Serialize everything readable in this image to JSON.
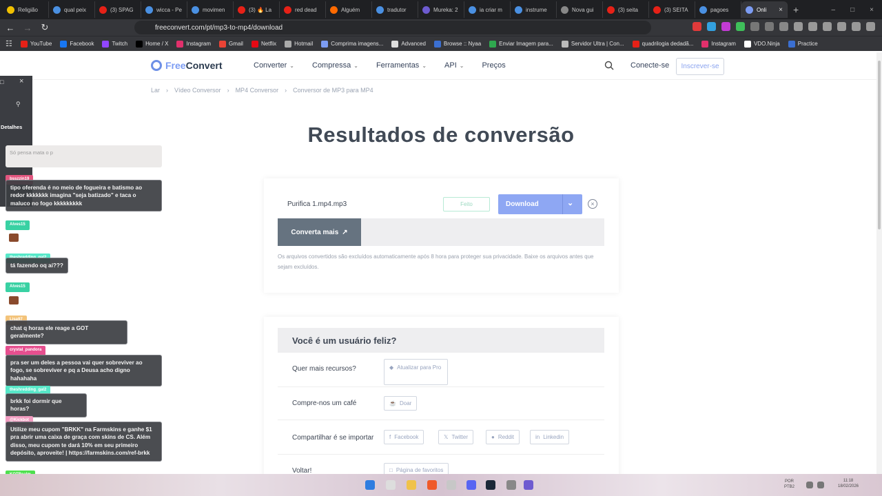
{
  "tabs": [
    {
      "label": "Religião",
      "color": "#f0c000"
    },
    {
      "label": "qual peix",
      "color": "#4a90e2"
    },
    {
      "label": "(3) SPAG",
      "color": "#e62117"
    },
    {
      "label": "wicca - Pe",
      "color": "#4a90e2"
    },
    {
      "label": "movimen",
      "color": "#4a90e2"
    },
    {
      "label": "(3) 🔥 La",
      "color": "#e62117"
    },
    {
      "label": "red dead",
      "color": "#e62117"
    },
    {
      "label": "Alguém",
      "color": "#ff6a00"
    },
    {
      "label": "tradutor",
      "color": "#4a90e2"
    },
    {
      "label": "Mureka: 2",
      "color": "#6d5bd0"
    },
    {
      "label": "ia criar m",
      "color": "#4a90e2"
    },
    {
      "label": "instrume",
      "color": "#4a90e2"
    },
    {
      "label": "Nova gui",
      "color": "#888888"
    },
    {
      "label": "(3) seita",
      "color": "#e62117"
    },
    {
      "label": "(3) SEITA",
      "color": "#e62117"
    },
    {
      "label": "pagoes",
      "color": "#4a90e2"
    },
    {
      "label": "Onli",
      "color": "#7c9cf3",
      "active": true
    }
  ],
  "address": {
    "url": "freeconvert.com/pt/mp3-to-mp4/download"
  },
  "bookmarks": [
    {
      "label": "YouTube",
      "color": "#e62117"
    },
    {
      "label": "Facebook",
      "color": "#1877f2"
    },
    {
      "label": "Twitch",
      "color": "#9146ff"
    },
    {
      "label": "Home / X",
      "color": "#000000"
    },
    {
      "label": "Instagram",
      "color": "#e1306c"
    },
    {
      "label": "Gmail",
      "color": "#ea4335"
    },
    {
      "label": "Netflix",
      "color": "#e50914"
    },
    {
      "label": "Hotmail",
      "color": "#aaaaaa"
    },
    {
      "label": "Comprima imagens...",
      "color": "#7c9cf3"
    },
    {
      "label": "Advanced",
      "color": "#dddddd"
    },
    {
      "label": "Browse :: Nyaa",
      "color": "#3b6fd1"
    },
    {
      "label": "Enviar Imagem para...",
      "color": "#2fa84f"
    },
    {
      "label": "Servidor Ultra | Con...",
      "color": "#bbbbbb"
    },
    {
      "label": "quadrilogia dedadã...",
      "color": "#e62117"
    },
    {
      "label": "Instagram",
      "color": "#e1306c"
    },
    {
      "label": "VDO.Ninja",
      "color": "#ffffff"
    },
    {
      "label": "Practice",
      "color": "#3b6fd1"
    }
  ],
  "header": {
    "logo_free": "Free",
    "logo_convert": "Convert",
    "nav": [
      "Converter",
      "Compressa",
      "Ferramentas",
      "API",
      "Preços"
    ],
    "login": "Conecte-se",
    "signup": "Inscrever-se"
  },
  "breadcrumb": [
    "Lar",
    "Vídeo Conversor",
    "MP4 Conversor",
    "Conversor de MP3 para MP4"
  ],
  "main": {
    "title": "Resultados de conversão",
    "file_name": "Purifica 1.mp4.mp3",
    "status": "Feito",
    "download": "Download",
    "convert_more": "Converta mais",
    "note": "Os arquivos convertidos são excluídos automaticamente após 8 hora para proteger sua privacidade. Baixe os arquivos antes que sejam excluídos."
  },
  "happy": {
    "heading": "Você é um usuário feliz?",
    "rows": [
      {
        "label": "Quer mais recursos?",
        "buttons": [
          "Atualizar para Pro"
        ]
      },
      {
        "label": "Compre-nos um café",
        "buttons": [
          "Doar"
        ]
      },
      {
        "label": "Compartilhar é se importar",
        "buttons": [
          "Facebook",
          "Twitter",
          "Reddit",
          "Linkedin"
        ]
      },
      {
        "label": "Voltar!",
        "buttons": [
          "Página de favoritos"
        ]
      }
    ]
  },
  "chat": {
    "panel_tab": "Detalhes",
    "faded_text": "Só pensa mata o p",
    "messages": [
      {
        "user": "bsszzin19",
        "ucolor": "#e2567f",
        "text": "tipo oferenda é no meio de fogueira e batismo ao redor kkkkkkk imagina \"seja batizado\" e taca o maluco no fogo kkkkkkkkk"
      },
      {
        "user": "Alves15",
        "ucolor": "#39d1a3",
        "emote": true
      },
      {
        "user": "theshredding_gal2",
        "ucolor": "#57e8c9",
        "text": "tá fazendo oq aí???"
      },
      {
        "user": "Alves15",
        "ucolor": "#39d1a3",
        "emote": true
      },
      {
        "user": "Lisa97",
        "ucolor": "#f3c37a",
        "text": "chat q horas ele reage a GOT geralmente?"
      },
      {
        "user": "crystal_pandora",
        "ucolor": "#e64f8f",
        "text": "pra ser um deles a pessoa vai quer sobreviver ao fogo, se sobreviver e pq a Deusa acho digno hahahaha"
      },
      {
        "user": "theshredding_gal2",
        "ucolor": "#57e8c9",
        "text": "brkk foi dormir que horas?"
      },
      {
        "user": "@Kickbot",
        "ucolor": "#f19bc0",
        "text": "Utilize meu cupom \"BRKK\" na Farmskins e ganhe $1 pra abrir uma caixa de graça com skins de CS. Além disso, meu cupom te dará 10% em seu primeiro depósito, aproveite! | https://farmskins.com/ref-brkk"
      },
      {
        "user": "KOTRealm",
        "ucolor": "#4ee04e",
        "emote": true
      }
    ]
  },
  "taskbar": {
    "lang": "POR",
    "layout": "PTB2",
    "time": "11:18",
    "date": "18/02/2026"
  }
}
